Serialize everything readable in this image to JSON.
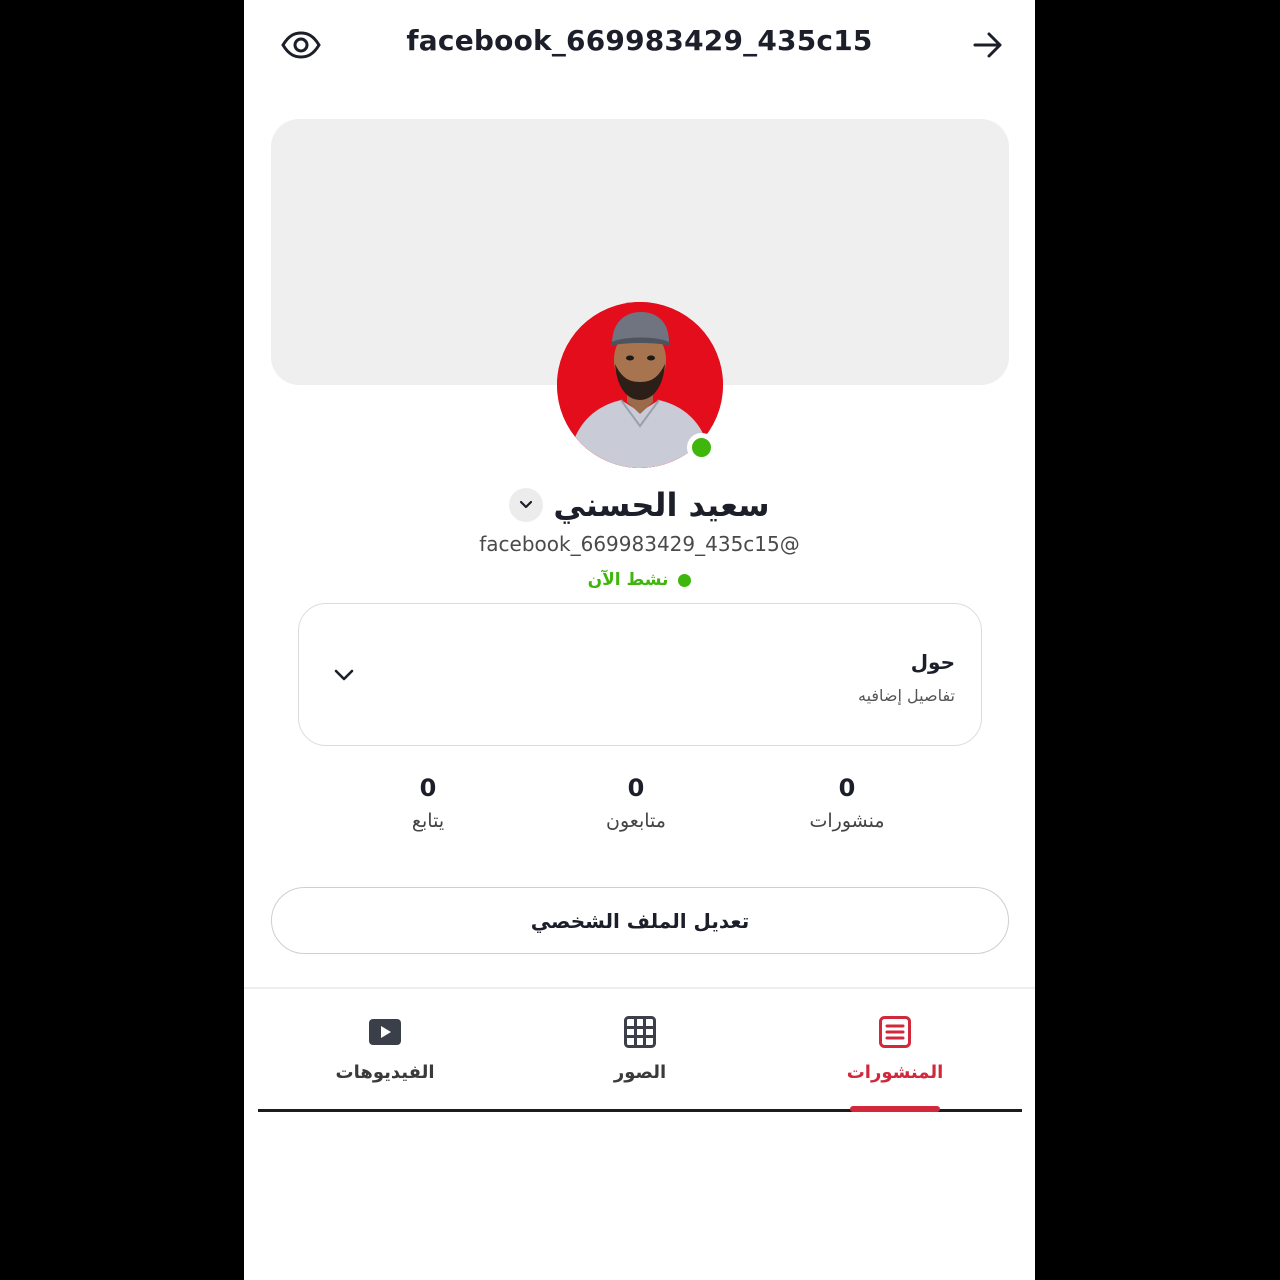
{
  "header": {
    "title": "facebook_669983429_435c15"
  },
  "profile": {
    "name": "سعيد الحسني",
    "handle": "facebook_669983429_435c15@",
    "status": "نشط الآن"
  },
  "about": {
    "title": "حول",
    "subtitle": "تفاصيل إضافيه"
  },
  "stats": [
    {
      "value": "0",
      "label": "منشورات"
    },
    {
      "value": "0",
      "label": "متابعون"
    },
    {
      "value": "0",
      "label": "يتابع"
    }
  ],
  "edit_button": {
    "label": "تعديل الملف الشخصي"
  },
  "tabs": [
    {
      "label": "المنشورات",
      "icon": "posts-icon",
      "active": true
    },
    {
      "label": "الصور",
      "icon": "grid-icon",
      "active": false
    },
    {
      "label": "الفيديوهات",
      "icon": "video-icon",
      "active": false
    }
  ],
  "colors": {
    "accent": "#d1283b",
    "online": "#3fb60b",
    "avatar_bg": "#e30d1c"
  }
}
